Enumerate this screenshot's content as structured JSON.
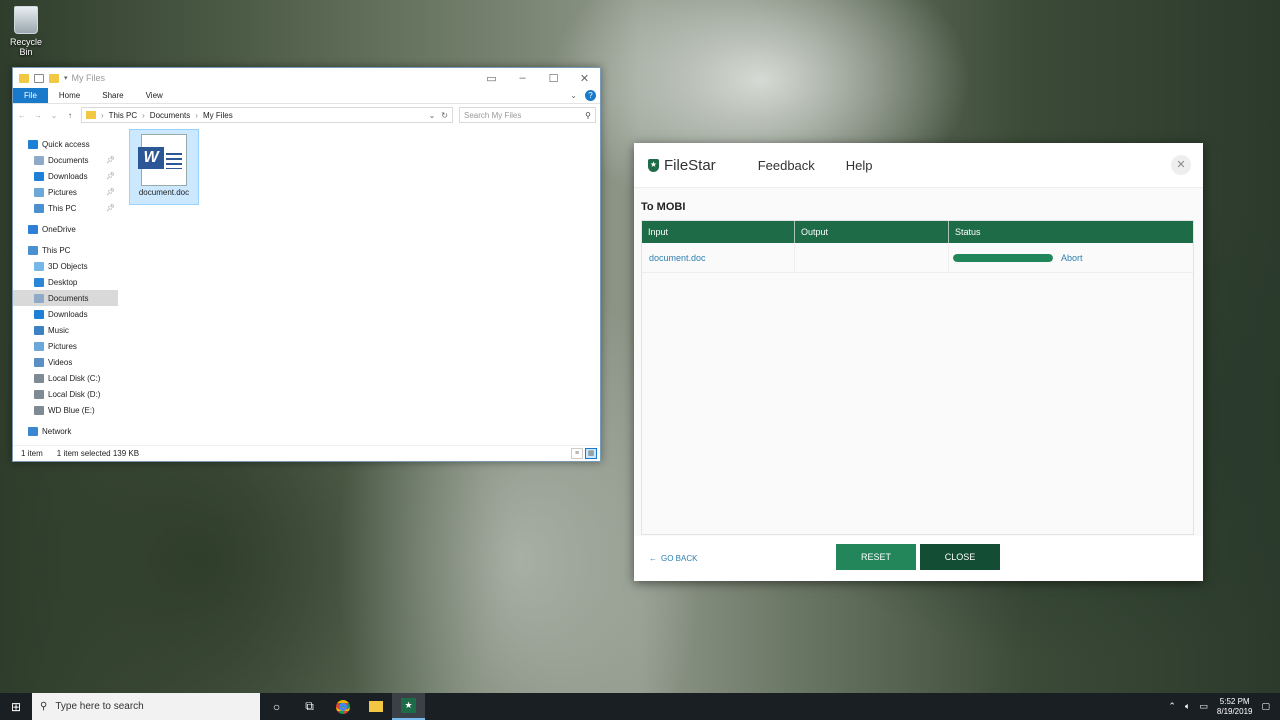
{
  "desktop": {
    "recycle_bin_label": "Recycle Bin"
  },
  "explorer": {
    "title": "My Files",
    "ribbon_tabs": [
      "File",
      "Home",
      "Share",
      "View"
    ],
    "breadcrumb": [
      "This PC",
      "Documents",
      "My Files"
    ],
    "search_placeholder": "Search My Files",
    "nav": [
      {
        "label": "Quick access",
        "icon": "star-icon",
        "color": "#1e7fd6"
      },
      {
        "label": "Documents",
        "icon": "documents-icon",
        "color": "#8fa9c8",
        "pinned": true
      },
      {
        "label": "Downloads",
        "icon": "download-arrow-icon",
        "color": "#1e7fd6",
        "pinned": true
      },
      {
        "label": "Pictures",
        "icon": "pictures-icon",
        "color": "#6ba7d8",
        "pinned": true
      },
      {
        "label": "This PC",
        "icon": "computer-icon",
        "color": "#4a8fd0",
        "pinned": true
      },
      {
        "label": "OneDrive",
        "icon": "cloud-icon",
        "color": "#2f7ed8"
      },
      {
        "label": "This PC",
        "icon": "computer-icon",
        "color": "#4a8fd0"
      },
      {
        "label": "3D Objects",
        "icon": "cube-icon",
        "color": "#74b7e8"
      },
      {
        "label": "Desktop",
        "icon": "desktop-icon",
        "color": "#2a86d6"
      },
      {
        "label": "Documents",
        "icon": "documents-icon",
        "color": "#8fa9c8"
      },
      {
        "label": "Downloads",
        "icon": "download-arrow-icon",
        "color": "#1e7fd6"
      },
      {
        "label": "Music",
        "icon": "music-note-icon",
        "color": "#3b82c4"
      },
      {
        "label": "Pictures",
        "icon": "pictures-icon",
        "color": "#6ba7d8"
      },
      {
        "label": "Videos",
        "icon": "video-icon",
        "color": "#5b8fc4"
      },
      {
        "label": "Local Disk (C:)",
        "icon": "drive-icon",
        "color": "#7f8b94"
      },
      {
        "label": "Local Disk (D:)",
        "icon": "drive-icon",
        "color": "#7f8b94"
      },
      {
        "label": "WD Blue (E:)",
        "icon": "drive-icon",
        "color": "#7f8b94"
      },
      {
        "label": "Network",
        "icon": "network-icon",
        "color": "#3a86d0"
      }
    ],
    "file": {
      "name": "document.doc",
      "badge": "W"
    },
    "status": {
      "count": "1 item",
      "selection": "1 item selected  139 KB"
    }
  },
  "filestar": {
    "brand": "FileStar",
    "menu": [
      "Feedback",
      "Help"
    ],
    "section_title": "To MOBI",
    "table": {
      "headers": [
        "Input",
        "Output",
        "Status"
      ],
      "rows": [
        {
          "input": "document.doc",
          "output": "",
          "progress": 1.0,
          "action": "Abort"
        }
      ]
    },
    "footer": {
      "go_back": "GO BACK",
      "reset": "RESET",
      "close": "CLOSE"
    },
    "accent": "#1e6b47"
  },
  "taskbar": {
    "search_placeholder": "Type here to search",
    "time": "5:52 PM",
    "date": "8/19/2019"
  }
}
